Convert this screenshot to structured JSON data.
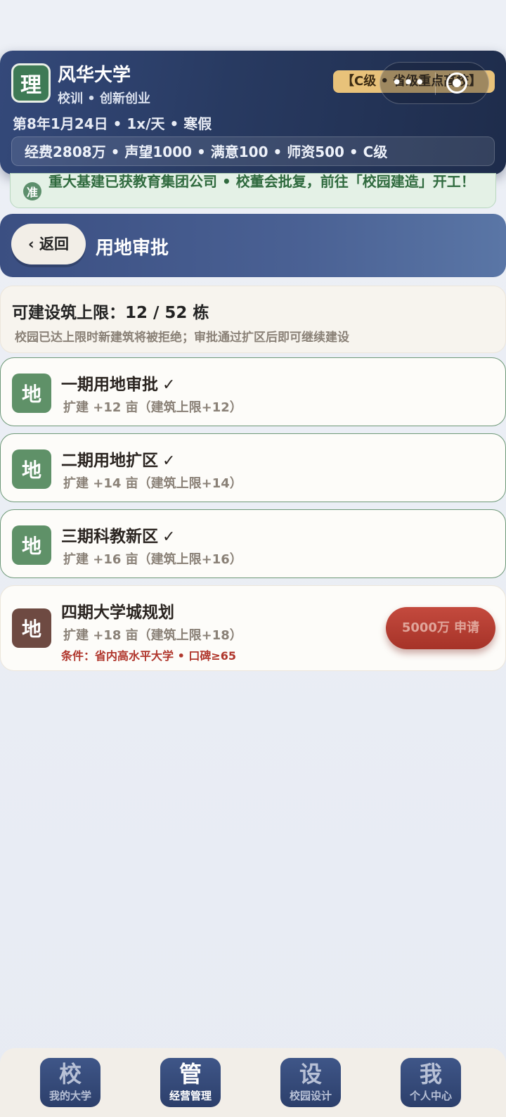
{
  "header": {
    "logo_char": "理",
    "university_name": "风华大学",
    "motto": "校训 • 创新创业",
    "date_line": "第8年1月24日 • 1x/天 • 寒假",
    "stats": "经费2808万 • 声望1000 • 满意100 • 师资500 • C级",
    "grade_badge": "【C级 • 省级重点高校】"
  },
  "capsule": {
    "more_icon": "more-dots-icon",
    "close_icon": "target-circle-icon"
  },
  "notice": {
    "icon_char": "准",
    "text": "重大基建已获教育集团公司 • 校董会批复，前往「校园建造」开工！"
  },
  "titlebar": {
    "back_label": "‹ 返回",
    "title": "用地审批"
  },
  "limit": {
    "title": "可建设筑上限：12 / 52 栋",
    "subtitle": "校园已达上限时新建筑将被拒绝；审批通过扩区后即可继续建设"
  },
  "lands": [
    {
      "icon_char": "地",
      "name": "一期用地审批",
      "check": "✓",
      "detail": "扩建 +12 亩（建筑上限+12）"
    },
    {
      "icon_char": "地",
      "name": "二期用地扩区",
      "check": "✓",
      "detail": "扩建 +14 亩（建筑上限+14）"
    },
    {
      "icon_char": "地",
      "name": "三期科教新区",
      "check": "✓",
      "detail": "扩建 +16 亩（建筑上限+16）"
    },
    {
      "icon_char": "地",
      "name": "四期大学城规划",
      "detail": "扩建 +18 亩（建筑上限+18）",
      "condition": "条件：省内高水平大学 • 口碑≥65",
      "apply_label": "5000万 申请"
    }
  ],
  "tabs": [
    {
      "glyph": "校",
      "label": "我的大学"
    },
    {
      "glyph": "管",
      "label": "经营管理"
    },
    {
      "glyph": "设",
      "label": "校园设计"
    },
    {
      "glyph": "我",
      "label": "个人中心"
    }
  ],
  "colors": {
    "header_bg": "#283a61",
    "accent_green": "#5f9168",
    "notice_text": "#2f6a3e",
    "apply_button": "#b83c30",
    "condition_text": "#b0362c",
    "grade_badge": "#e8c27a"
  }
}
